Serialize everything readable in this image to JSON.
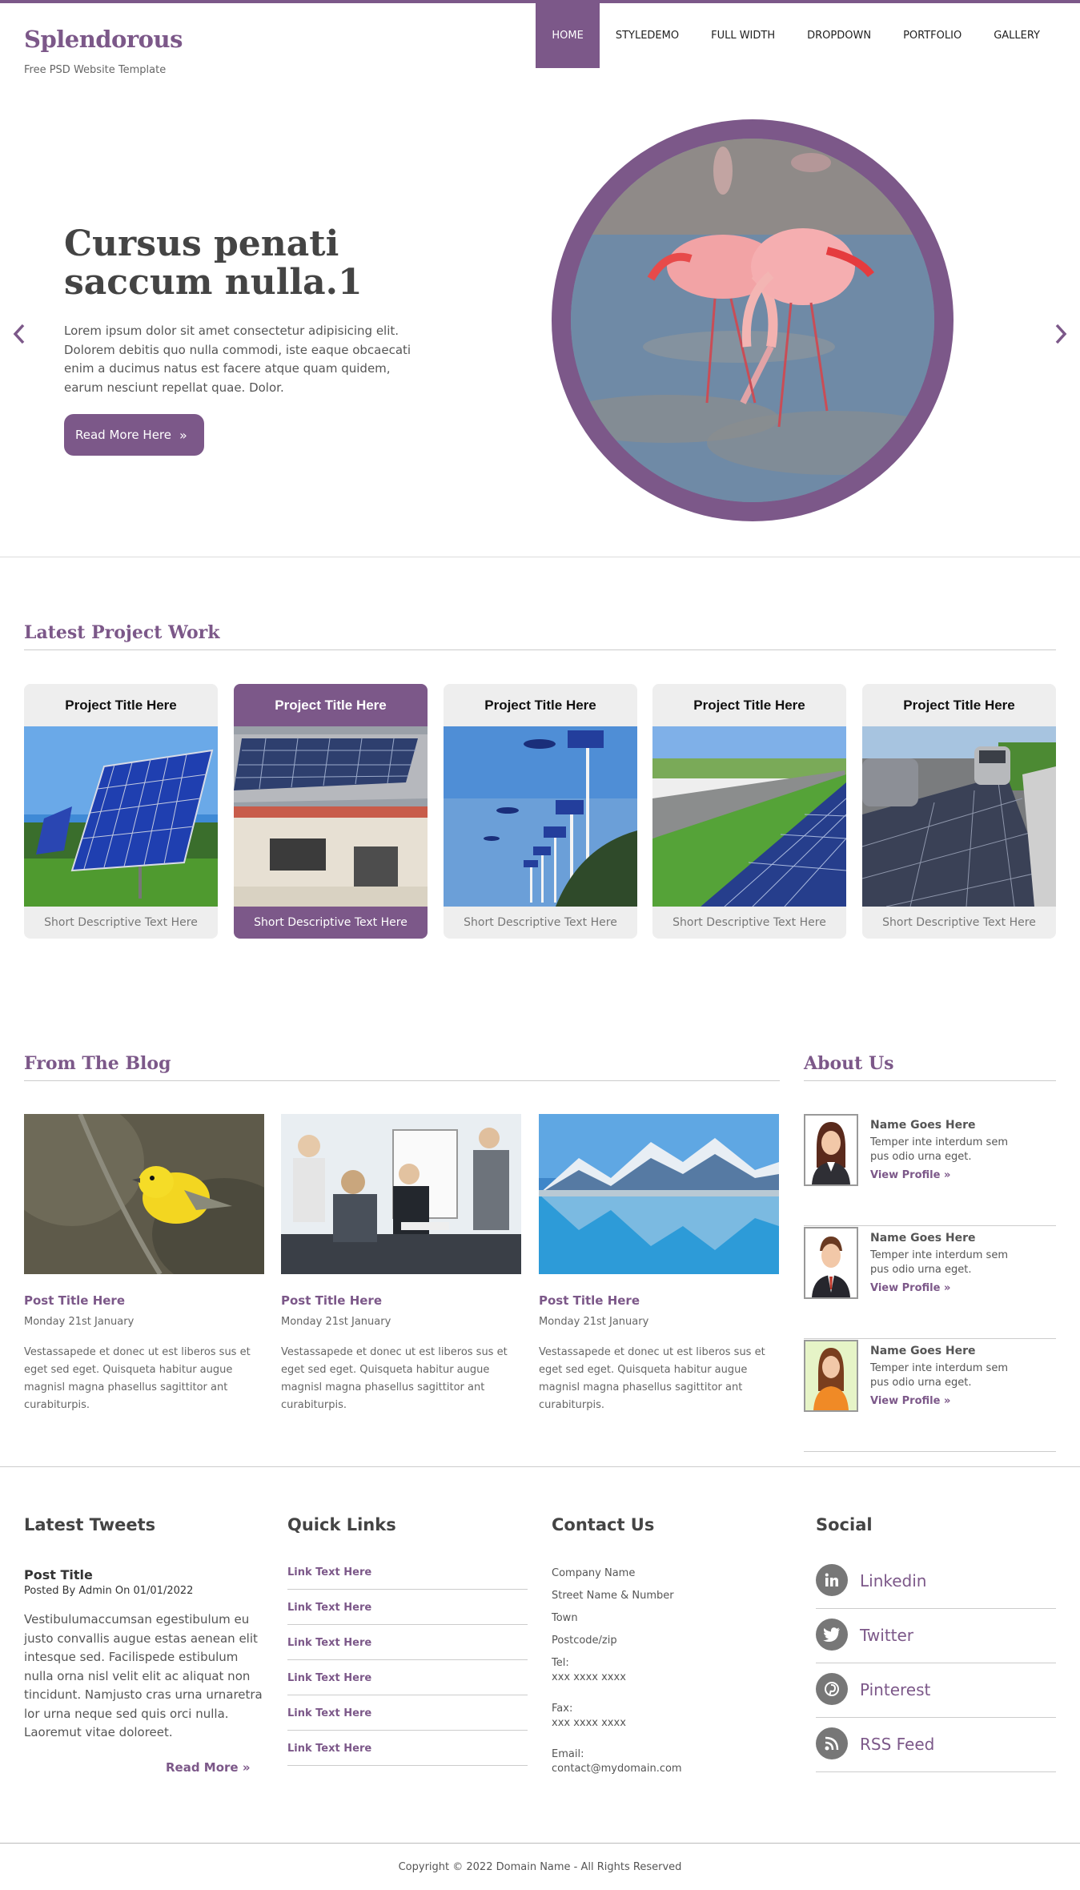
{
  "site": {
    "name": "Splendorous",
    "tagline": "Free PSD Website Template",
    "accent": "#7c5889"
  },
  "nav": {
    "items": [
      "HOME",
      "STYLEDEMO",
      "FULL WIDTH",
      "DROPDOWN",
      "PORTFOLIO",
      "GALLERY"
    ],
    "active": "HOME"
  },
  "slider": {
    "title": "Cursus penati saccum nulla.1",
    "text": "Lorem ipsum dolor sit amet consectetur adipisicing elit. Dolorem debitis quo nulla commodi, iste eaque obcaecati enim a ducimus natus est facere atque quam quidem, earum nesciunt repellat quae. Dolor.",
    "button": "Read More Here",
    "prev_icon": "chevron-left-icon",
    "next_icon": "chevron-right-icon"
  },
  "projects": {
    "heading": "Latest Project Work",
    "items": [
      {
        "title": "Project Title Here",
        "desc": "Short Descriptive Text Here"
      },
      {
        "title": "Project Title Here",
        "desc": "Short Descriptive Text Here"
      },
      {
        "title": "Project Title Here",
        "desc": "Short Descriptive Text Here"
      },
      {
        "title": "Project Title Here",
        "desc": "Short Descriptive Text Here"
      },
      {
        "title": "Project Title Here",
        "desc": "Short Descriptive Text Here"
      }
    ]
  },
  "blog": {
    "heading": "From The Blog",
    "posts": [
      {
        "title": "Post Title Here",
        "date": "Monday 21st January",
        "text": "Vestassapede et donec ut est liberos sus et eget sed eget. Quisqueta habitur augue magnisl magna phasellus sagittitor ant curabiturpis."
      },
      {
        "title": "Post Title Here",
        "date": "Monday 21st January",
        "text": "Vestassapede et donec ut est liberos sus et eget sed eget. Quisqueta habitur augue magnisl magna phasellus sagittitor ant curabiturpis."
      },
      {
        "title": "Post Title Here",
        "date": "Monday 21st January",
        "text": "Vestassapede et donec ut est liberos sus et eget sed eget. Quisqueta habitur augue magnisl magna phasellus sagittitor ant curabiturpis."
      }
    ]
  },
  "about": {
    "heading": "About Us",
    "people": [
      {
        "name": "Name Goes Here",
        "text": "Temper inte interdum sem pus odio urna eget.",
        "link": "View Profile"
      },
      {
        "name": "Name Goes Here",
        "text": "Temper inte interdum sem pus odio urna eget.",
        "link": "View Profile"
      },
      {
        "name": "Name Goes Here",
        "text": "Temper inte interdum sem pus odio urna eget.",
        "link": "View Profile"
      }
    ]
  },
  "footer": {
    "tweets": {
      "heading": "Latest Tweets",
      "title": "Post Title",
      "meta": "Posted By Admin On 01/01/2022",
      "text": "Vestibulumaccumsan egestibulum eu justo convallis augue estas aenean elit intesque sed. Facilispede estibulum nulla orna nisl velit elit ac aliquat non tincidunt. Namjusto cras urna urnaretra lor urna neque sed quis orci nulla. Laoremut vitae doloreet.",
      "read_more": "Read More"
    },
    "quick_links": {
      "heading": "Quick Links",
      "items": [
        "Link Text Here",
        "Link Text Here",
        "Link Text Here",
        "Link Text Here",
        "Link Text Here",
        "Link Text Here"
      ]
    },
    "contact": {
      "heading": "Contact Us",
      "company": "Company Name",
      "street": "Street Name & Number",
      "town": "Town",
      "postcode": "Postcode/zip",
      "tel_label": "Tel:",
      "tel": "xxx xxxx xxxx",
      "fax_label": "Fax:",
      "fax": "xxx xxxx xxxx",
      "email_label": "Email:",
      "email": "contact@mydomain.com"
    },
    "social": {
      "heading": "Social",
      "items": [
        {
          "label": "Linkedin",
          "icon": "linkedin-icon"
        },
        {
          "label": "Twitter",
          "icon": "twitter-icon"
        },
        {
          "label": "Pinterest",
          "icon": "pinterest-icon"
        },
        {
          "label": "RSS Feed",
          "icon": "rss-icon"
        }
      ]
    },
    "copyright": "Copyright © 2022 Domain Name - All Rights Reserved"
  }
}
